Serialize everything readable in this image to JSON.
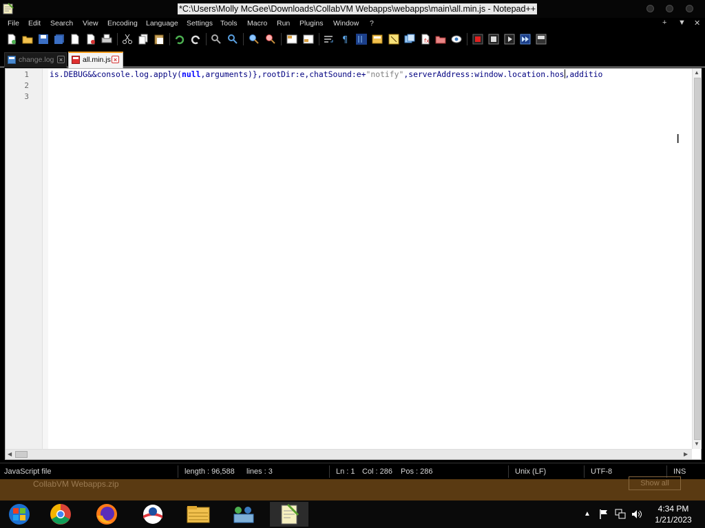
{
  "window": {
    "title": "*C:\\Users\\Molly McGee\\Downloads\\CollabVM Webapps\\webapps\\main\\all.min.js - Notepad++"
  },
  "menu": {
    "items": [
      "File",
      "Edit",
      "Search",
      "View",
      "Encoding",
      "Language",
      "Settings",
      "Tools",
      "Macro",
      "Run",
      "Plugins",
      "Window",
      "?"
    ],
    "right": [
      "+",
      "▼",
      "✕"
    ]
  },
  "toolbar": {
    "icons": [
      "new-file",
      "open-file",
      "save",
      "save-all",
      "close",
      "close-all",
      "print",
      "cut",
      "copy",
      "paste",
      "undo",
      "redo",
      "find",
      "replace",
      "zoom-in",
      "zoom-out",
      "sync-vertical",
      "sync-horizontal",
      "word-wrap",
      "show-all-chars",
      "indent-guide",
      "document-map",
      "function-list",
      "folder-workspace",
      "monitoring",
      "record-macro",
      "stop-macro",
      "play-macro",
      "run-macro-multiple",
      "save-macro"
    ]
  },
  "tabs": [
    {
      "label": "change.log",
      "active": false
    },
    {
      "label": "all.min.js",
      "active": true
    }
  ],
  "editor": {
    "line_numbers": [
      "1",
      "2",
      "3"
    ],
    "line1": {
      "p1": "is.DEBUG&&console.log.apply(",
      "kw_null": "null",
      "p2": ",arguments)},rootDir:e,chatSound:e+",
      "str": "\"notify\"",
      "p3": ",serverAddress:window.location.hos",
      "p4": ",additio"
    }
  },
  "status": {
    "file_type": "JavaScript file",
    "length": "length : 96,588",
    "lines": "lines : 3",
    "ln": "Ln : 1",
    "col": "Col : 286",
    "pos": "Pos : 286",
    "eol": "Unix (LF)",
    "encoding": "UTF-8",
    "mode": "INS"
  },
  "download_bar": {
    "file": "CollabVM Webapps.zip",
    "button": "Show all"
  },
  "taskbar": {
    "apps": [
      "start",
      "chrome",
      "firefox",
      "obama-app",
      "file-explorer",
      "network-app",
      "notepad-plus-plus"
    ],
    "clock_time": "4:34 PM",
    "clock_date": "1/21/2023"
  },
  "colors": {
    "tab_accent": "#f59b1a",
    "close_red": "#d23030",
    "code_default": "#000080",
    "string_gray": "#808080"
  }
}
